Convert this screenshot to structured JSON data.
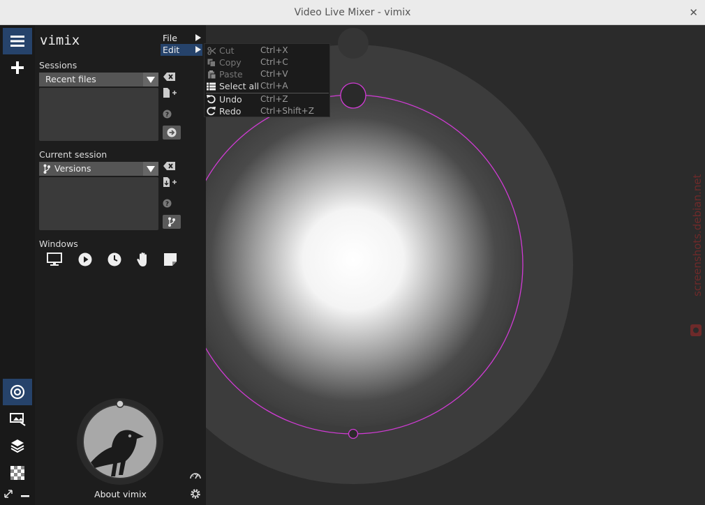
{
  "window": {
    "title": "Video Live Mixer - vimix",
    "close_glyph": "✕"
  },
  "app": {
    "name": "vimix"
  },
  "sessions": {
    "label": "Sessions",
    "selector_value": "Recent files",
    "clear_icon": "backspace-icon",
    "new_icon": "new-file-icon",
    "help_icon": "question-icon",
    "open_icon": "arrow-right-circle-icon"
  },
  "current_session": {
    "label": "Current session",
    "selector_value": "Versions",
    "branch_icon": "branch-icon"
  },
  "windows": {
    "label": "Windows",
    "items": [
      "monitor-icon",
      "play-icon",
      "clock-icon",
      "hand-icon",
      "note-icon"
    ]
  },
  "menu": {
    "items": [
      {
        "label": "File"
      },
      {
        "label": "Edit"
      }
    ],
    "edit": [
      {
        "label": "Cut",
        "shortcut": "Ctrl+X",
        "icon": "scissors-icon",
        "enabled": false
      },
      {
        "label": "Copy",
        "shortcut": "Ctrl+C",
        "icon": "copy-icon",
        "enabled": false
      },
      {
        "label": "Paste",
        "shortcut": "Ctrl+V",
        "icon": "paste-icon",
        "enabled": false
      },
      {
        "label": "Select all",
        "shortcut": "Ctrl+A",
        "icon": "list-icon",
        "enabled": true
      },
      {
        "label": "Undo",
        "shortcut": "Ctrl+Z",
        "icon": "undo-icon",
        "enabled": true
      },
      {
        "label": "Redo",
        "shortcut": "Ctrl+Shift+Z",
        "icon": "redo-icon",
        "enabled": true
      }
    ]
  },
  "about": {
    "label": "About vimix"
  },
  "watermark": {
    "text": "screenshots.debian.net"
  },
  "colors": {
    "accent": "#26436b",
    "circle": "#d23bd6",
    "panel": "#1d1d1d"
  }
}
